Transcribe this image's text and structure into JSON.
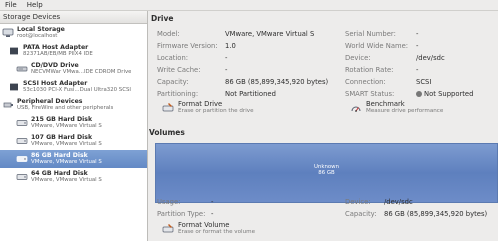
{
  "menubar": {
    "file": "File",
    "help": "Help"
  },
  "sidebar": {
    "header": "Storage Devices",
    "items": [
      {
        "title": "Local Storage",
        "subtitle": "root@localhost"
      },
      {
        "title": "PATA Host Adapter",
        "subtitle": "82371AB/EB/MB PIIX4 IDE"
      },
      {
        "title": "CD/DVD Drive",
        "subtitle": "NECVMWar VMwa...IDE CDROM Drive"
      },
      {
        "title": "SCSI Host Adapter",
        "subtitle": "53c1030 PCI-X Fusi...Dual Ultra320 SCSI"
      },
      {
        "title": "Peripheral Devices",
        "subtitle": "USB, FireWire and other peripherals"
      },
      {
        "title": "215 GB Hard Disk",
        "subtitle": "VMware, VMware Virtual S"
      },
      {
        "title": "107 GB Hard Disk",
        "subtitle": "VMware, VMware Virtual S"
      },
      {
        "title": "86 GB Hard Disk",
        "subtitle": "VMware, VMware Virtual S"
      },
      {
        "title": "64 GB Hard Disk",
        "subtitle": "VMware, VMware Virtual S"
      }
    ]
  },
  "drive": {
    "title": "Drive",
    "model_k": "Model:",
    "model_v": "VMware, VMware Virtual S",
    "firmware_k": "Firmware Version:",
    "firmware_v": "1.0",
    "location_k": "Location:",
    "location_v": "-",
    "writecache_k": "Write Cache:",
    "writecache_v": "-",
    "capacity_k": "Capacity:",
    "capacity_v": "86 GB (85,899,345,920 bytes)",
    "partitioning_k": "Partitioning:",
    "partitioning_v": "Not Partitioned",
    "serial_k": "Serial Number:",
    "serial_v": "-",
    "wwn_k": "World Wide Name:",
    "wwn_v": "-",
    "device_k": "Device:",
    "device_v": "/dev/sdc",
    "rotation_k": "Rotation Rate:",
    "rotation_v": "-",
    "connection_k": "Connection:",
    "connection_v": "SCSI",
    "smart_k": "SMART Status:",
    "smart_v": "Not Supported",
    "format_label": "Format Drive",
    "format_desc": "Erase or partition the drive",
    "bench_label": "Benchmark",
    "bench_desc": "Measure drive performance"
  },
  "volumes": {
    "title": "Volumes",
    "graph_line1": "Unknown",
    "graph_line2": "86 GB",
    "usage_k": "Usage:",
    "usage_v": "-",
    "ptype_k": "Partition Type:",
    "ptype_v": "-",
    "device_k": "Device:",
    "device_v": "/dev/sdc",
    "capacity_k": "Capacity:",
    "capacity_v": "86 GB (85,899,345,920 bytes)",
    "format_label": "Format Volume",
    "format_desc": "Erase or format the volume"
  }
}
